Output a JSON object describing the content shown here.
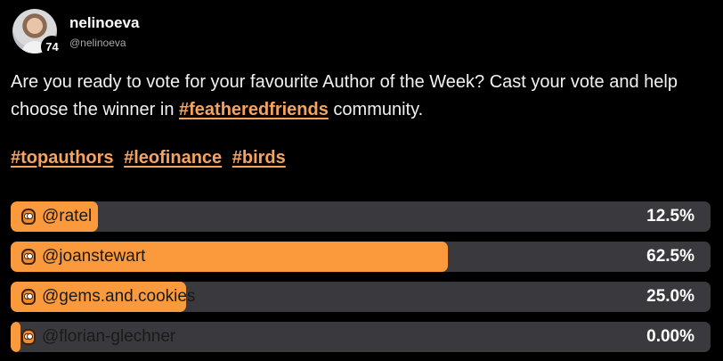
{
  "user": {
    "display_name": "nelinoeva",
    "handle": "@nelinoeva",
    "level": "74"
  },
  "post": {
    "text_before": "Are you ready to vote for your favourite Author of the Week? Cast your vote and help choose the winner in ",
    "community_tag": "#featheredfriends",
    "text_after": " community.",
    "hashtags": [
      "#topauthors",
      "#leofinance",
      "#birds"
    ]
  },
  "poll": {
    "options": [
      {
        "label": "@ratel",
        "percent_text": "12.5%",
        "percent": 12.5
      },
      {
        "label": "@joanstewart",
        "percent_text": "62.5%",
        "percent": 62.5
      },
      {
        "label": "@gems.and.cookies",
        "percent_text": "25.0%",
        "percent": 25.0
      },
      {
        "label": "@florian-glechner",
        "percent_text": "0.00%",
        "percent": 0
      }
    ]
  },
  "colors": {
    "accent": "#fb9a3c",
    "hashtag": "#f7a35c",
    "track": "#3a3a3e",
    "background": "#000000"
  },
  "icons": {
    "poll_option": "owl-icon"
  }
}
